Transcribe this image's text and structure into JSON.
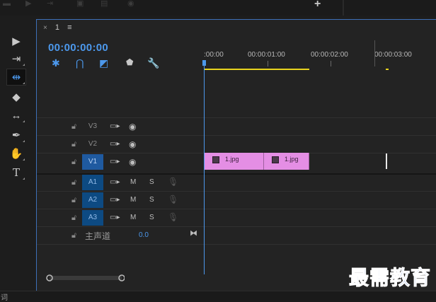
{
  "topbar": {
    "add_label": "+"
  },
  "tools": [
    {
      "name": "selection-tool",
      "glyph": "▶"
    },
    {
      "name": "track-select-tool",
      "glyph": "⇥"
    },
    {
      "name": "ripple-edit-tool",
      "glyph": "⇹"
    },
    {
      "name": "razor-tool",
      "glyph": "◆"
    },
    {
      "name": "slip-tool",
      "glyph": "↔"
    },
    {
      "name": "pen-tool",
      "glyph": "✒"
    },
    {
      "name": "hand-tool",
      "glyph": "✋"
    },
    {
      "name": "type-tool",
      "glyph": "T"
    }
  ],
  "panel": {
    "close_glyph": "×",
    "sequence_name": "1",
    "menu_glyph": "≡",
    "timecode": "00:00:00:00"
  },
  "ruler": {
    "labels": [
      ":00:00",
      "00:00:01:00",
      "00:00:02:00",
      "00:00:03:00"
    ]
  },
  "tracks": [
    {
      "label": "V3",
      "kind": "video"
    },
    {
      "label": "V2",
      "kind": "video"
    },
    {
      "label": "V1",
      "kind": "video",
      "selected": true
    },
    {
      "label": "A1",
      "kind": "audio",
      "m": "M",
      "s": "S"
    },
    {
      "label": "A2",
      "kind": "audio",
      "m": "M",
      "s": "S"
    },
    {
      "label": "A3",
      "kind": "audio",
      "m": "M",
      "s": "S"
    }
  ],
  "master": {
    "label": "主声道",
    "value": "0.0"
  },
  "clips": [
    {
      "name": "1.jpg"
    },
    {
      "name": "1.jpg"
    }
  ],
  "watermark": "最需教育",
  "status_text": "词"
}
